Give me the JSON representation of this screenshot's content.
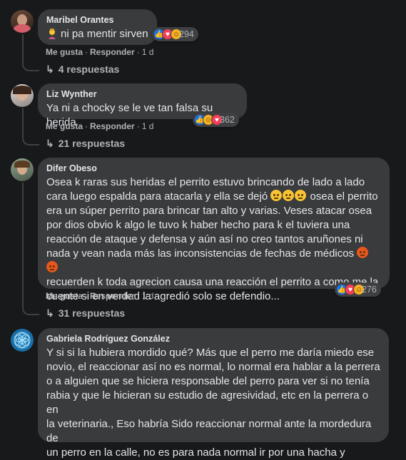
{
  "comments": [
    {
      "author": "Maribel Orantes",
      "text": "ni pa mentir sirven",
      "emoji_prefix": "woman-facepalming-icon",
      "actions": {
        "like": "Me gusta",
        "reply": "Responder",
        "time": "1 d"
      },
      "reaction_count": "294",
      "reactions": [
        "like",
        "love",
        "haha"
      ],
      "replies": "4 respuestas"
    },
    {
      "author": "Liz Wynther",
      "text": "Ya ni a chocky se le ve tan falsa su herida",
      "actions": {
        "like": "Me gusta",
        "reply": "Responder",
        "time": "1 d"
      },
      "reaction_count": "362",
      "reactions": [
        "like",
        "haha",
        "love"
      ],
      "replies": "21 respuestas"
    },
    {
      "author": "Difer Obeso",
      "lines": [
        "Osea k raras sus heridas el perrito estuvo brincando de lado a lado",
        "cara luego espalda para atacarla y ella se dejó",
        "osea el perrito",
        "era un súper perrito para brincar tan alto y varias. Veses atacar osea",
        "por dios obvio k algo le tuvo k haber hecho para k el tuviera una",
        "reacción de ataque y defensa y aún así no creo tantos aruñones ni",
        "nada y vean nada más las inconsistencias de fechas de médicos",
        "recuerden k toda agrecion causa una reacción el perrito a como me la",
        "cuente si en verdad la agredió solo se defendio..."
      ],
      "actions": {
        "like": "Me gusta",
        "reply": "Responder",
        "time": "1 d"
      },
      "reaction_count": "276",
      "reactions": [
        "like",
        "love",
        "haha"
      ],
      "replies": "31 respuestas"
    },
    {
      "author": "Gabriela Rodríguez González",
      "lines": [
        "Y si si la hubiera mordido qué? Más que el perro me daría miedo ese",
        "novio, el reaccionar así no es normal, lo normal era hablar a la perrera",
        "o a alguien que se hiciera responsable del perro para ver si no tenía",
        "rabia y que le hicieran su estudio de agresividad, etc en la perrera o en",
        "la veterinaria., Eso habría Sido reaccionar normal ante la mordedura de",
        "un perro en la calle, no es para nada normal ir por una hacha y"
      ]
    }
  ],
  "colors": {
    "bg": "#18191a",
    "bubble": "#3a3b3c",
    "text": "#e4e6eb",
    "muted": "#b0b3b8"
  }
}
